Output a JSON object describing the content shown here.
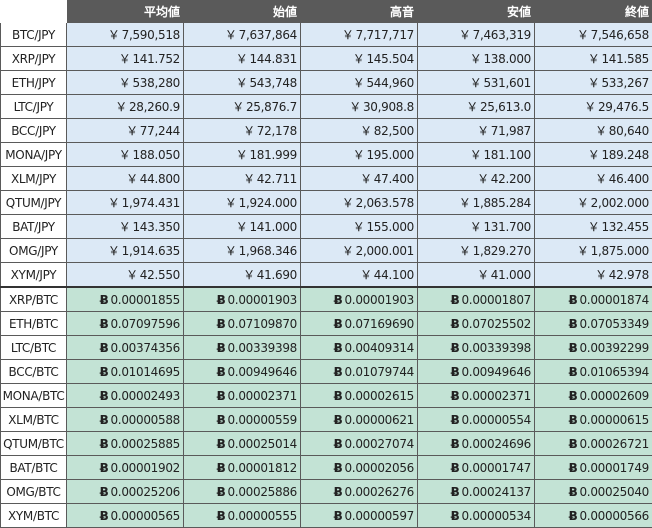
{
  "headers": [
    "平均値",
    "始値",
    "高音",
    "安値",
    "終値"
  ],
  "jpy_symbol": "￥",
  "btc_symbol": "Ƀ",
  "jpy_rows": [
    {
      "pair": "BTC/JPY",
      "values": [
        "7,590,518",
        "7,637,864",
        "7,717,717",
        "7,463,319",
        "7,546,658"
      ]
    },
    {
      "pair": "XRP/JPY",
      "values": [
        "141.752",
        "144.831",
        "145.504",
        "138.000",
        "141.585"
      ]
    },
    {
      "pair": "ETH/JPY",
      "values": [
        "538,280",
        "543,748",
        "544,960",
        "531,601",
        "533,267"
      ]
    },
    {
      "pair": "LTC/JPY",
      "values": [
        "28,260.9",
        "25,876.7",
        "30,908.8",
        "25,613.0",
        "29,476.5"
      ]
    },
    {
      "pair": "BCC/JPY",
      "values": [
        "77,244",
        "72,178",
        "82,500",
        "71,987",
        "80,640"
      ]
    },
    {
      "pair": "MONA/JPY",
      "values": [
        "188.050",
        "181.999",
        "195.000",
        "181.100",
        "189.248"
      ]
    },
    {
      "pair": "XLM/JPY",
      "values": [
        "44.800",
        "42.711",
        "47.400",
        "42.200",
        "46.400"
      ]
    },
    {
      "pair": "QTUM/JPY",
      "values": [
        "1,974.431",
        "1,924.000",
        "2,063.578",
        "1,885.284",
        "2,002.000"
      ]
    },
    {
      "pair": "BAT/JPY",
      "values": [
        "143.350",
        "141.000",
        "155.000",
        "131.700",
        "132.455"
      ]
    },
    {
      "pair": "OMG/JPY",
      "values": [
        "1,914.635",
        "1,968.346",
        "2,000.001",
        "1,829.270",
        "1,875.000"
      ]
    },
    {
      "pair": "XYM/JPY",
      "values": [
        "42.550",
        "41.690",
        "44.100",
        "41.000",
        "42.978"
      ]
    }
  ],
  "btc_rows": [
    {
      "pair": "XRP/BTC",
      "values": [
        "0.00001855",
        "0.00001903",
        "0.00001903",
        "0.00001807",
        "0.00001874"
      ]
    },
    {
      "pair": "ETH/BTC",
      "values": [
        "0.07097596",
        "0.07109870",
        "0.07169690",
        "0.07025502",
        "0.07053349"
      ]
    },
    {
      "pair": "LTC/BTC",
      "values": [
        "0.00374356",
        "0.00339398",
        "0.00409314",
        "0.00339398",
        "0.00392299"
      ]
    },
    {
      "pair": "BCC/BTC",
      "values": [
        "0.01014695",
        "0.00949646",
        "0.01079744",
        "0.00949646",
        "0.01065394"
      ]
    },
    {
      "pair": "MONA/BTC",
      "values": [
        "0.00002493",
        "0.00002371",
        "0.00002615",
        "0.00002371",
        "0.00002609"
      ]
    },
    {
      "pair": "XLM/BTC",
      "values": [
        "0.00000588",
        "0.00000559",
        "0.00000621",
        "0.00000554",
        "0.00000615"
      ]
    },
    {
      "pair": "QTUM/BTC",
      "values": [
        "0.00025885",
        "0.00025014",
        "0.00027074",
        "0.00024696",
        "0.00026721"
      ]
    },
    {
      "pair": "BAT/BTC",
      "values": [
        "0.00001902",
        "0.00001812",
        "0.00002056",
        "0.00001747",
        "0.00001749"
      ]
    },
    {
      "pair": "OMG/BTC",
      "values": [
        "0.00025206",
        "0.00025886",
        "0.00026276",
        "0.00024137",
        "0.00025040"
      ]
    },
    {
      "pair": "XYM/BTC",
      "values": [
        "0.00000565",
        "0.00000555",
        "0.00000597",
        "0.00000534",
        "0.00000566"
      ]
    }
  ]
}
